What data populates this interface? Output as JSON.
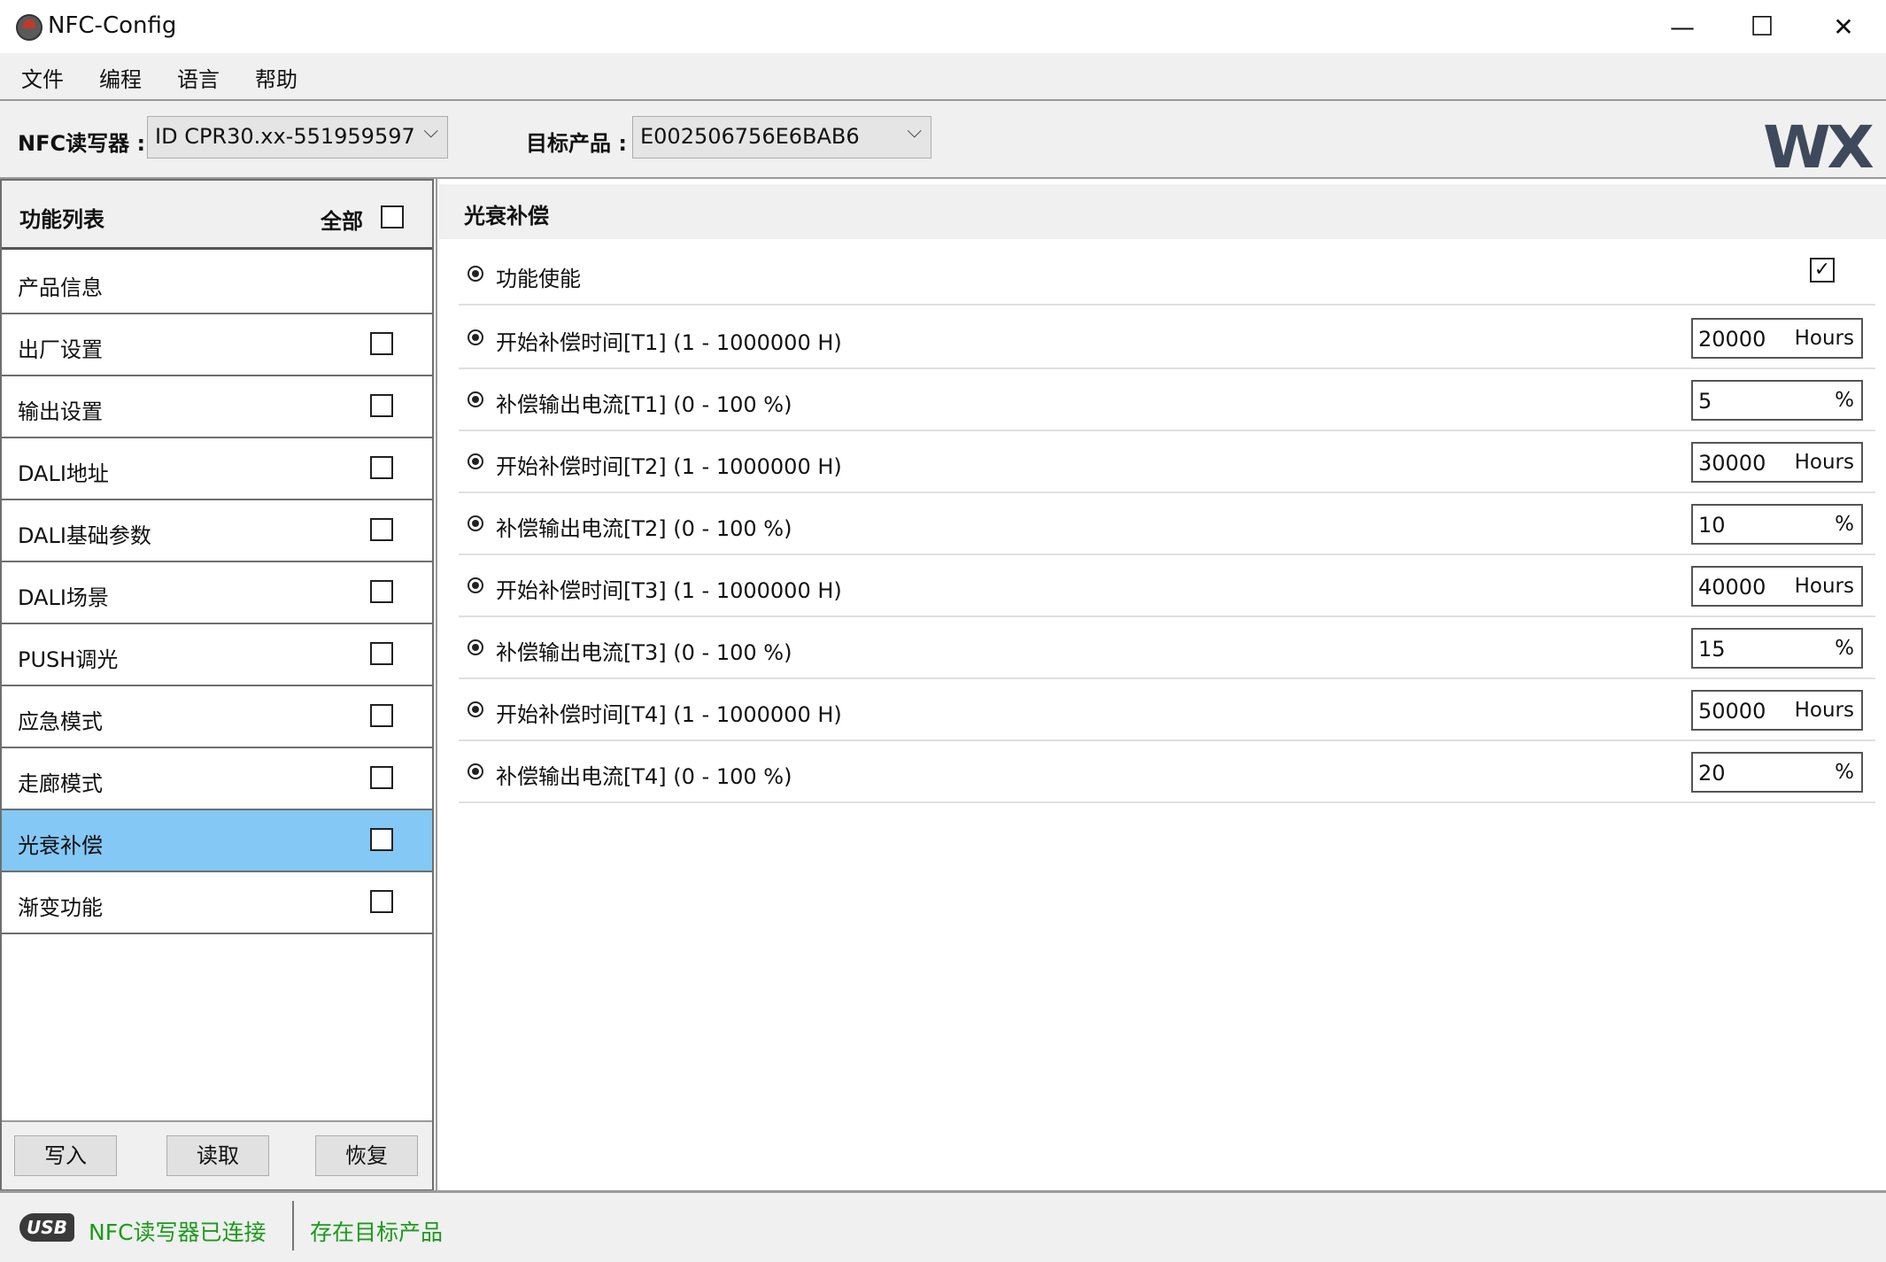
{
  "window": {
    "title": "NFC-Config",
    "minimize": "—",
    "maximize": "☐",
    "close": "✕"
  },
  "menu": [
    "文件",
    "编程",
    "语言",
    "帮助"
  ],
  "toolbar": {
    "reader_label": "NFC读写器 :",
    "reader_value": "ID CPR30.xx-551959597",
    "target_label": "目标产品 :",
    "target_value": "E002506756E6BAB6",
    "logo": "WX"
  },
  "left_panel": {
    "title": "功能列表",
    "all_label": "全部",
    "items": [
      {
        "label": "产品信息",
        "has_checkbox": false,
        "selected": false
      },
      {
        "label": "出厂设置",
        "has_checkbox": true,
        "selected": false
      },
      {
        "label": "输出设置",
        "has_checkbox": true,
        "selected": false
      },
      {
        "label": "DALI地址",
        "has_checkbox": true,
        "selected": false
      },
      {
        "label": "DALI基础参数",
        "has_checkbox": true,
        "selected": false
      },
      {
        "label": "DALI场景",
        "has_checkbox": true,
        "selected": false
      },
      {
        "label": "PUSH调光",
        "has_checkbox": true,
        "selected": false
      },
      {
        "label": "应急模式",
        "has_checkbox": true,
        "selected": false
      },
      {
        "label": "走廊模式",
        "has_checkbox": true,
        "selected": false
      },
      {
        "label": "光衰补偿",
        "has_checkbox": true,
        "selected": true
      },
      {
        "label": "渐变功能",
        "has_checkbox": true,
        "selected": false
      }
    ],
    "buttons": {
      "write": "写入",
      "read": "读取",
      "restore": "恢复"
    }
  },
  "right_panel": {
    "title": "光衰补偿",
    "enable_label": "功能使能",
    "enable_checked": "☑",
    "params": [
      {
        "label": "开始补偿时间[T1] (1 - 1000000 H)",
        "value": "20000",
        "unit": "Hours"
      },
      {
        "label": "补偿输出电流[T1] (0 - 100 %)",
        "value": "5",
        "unit": "%"
      },
      {
        "label": "开始补偿时间[T2] (1 - 1000000 H)",
        "value": "30000",
        "unit": "Hours"
      },
      {
        "label": "补偿输出电流[T2] (0 - 100 %)",
        "value": "10",
        "unit": "%"
      },
      {
        "label": "开始补偿时间[T3] (1 - 1000000 H)",
        "value": "40000",
        "unit": "Hours"
      },
      {
        "label": "补偿输出电流[T3] (0 - 100 %)",
        "value": "15",
        "unit": "%"
      },
      {
        "label": "开始补偿时间[T4] (1 - 1000000 H)",
        "value": "50000",
        "unit": "Hours"
      },
      {
        "label": "补偿输出电流[T4] (0 - 100 %)",
        "value": "20",
        "unit": "%"
      }
    ]
  },
  "status": {
    "usb_icon": "USB",
    "reader_status": "NFC读写器已连接",
    "target_status": "存在目标产品",
    "status_color": "#1c9a1c",
    "selected_color": "#84c8f6"
  }
}
